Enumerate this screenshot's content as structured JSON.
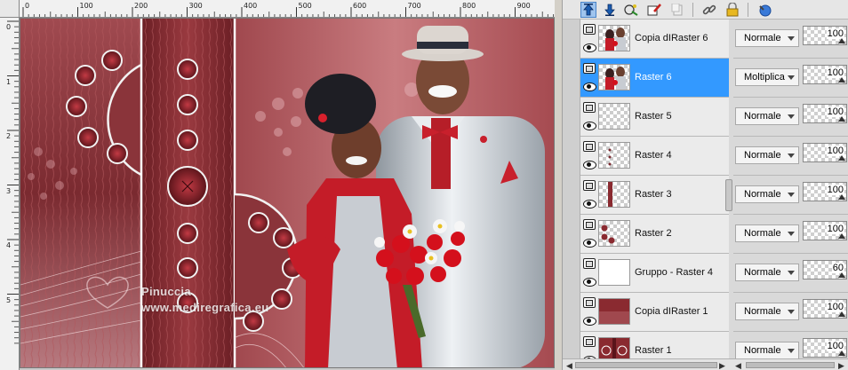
{
  "colors": {
    "selected_row": "#3399ff",
    "palette_bg": "#d9d9d9",
    "art_dark_red": "#7a2a30",
    "art_red": "#c0202a"
  },
  "ruler": {
    "top_labels": [
      "0",
      "100",
      "200",
      "300",
      "400",
      "500",
      "600",
      "700",
      "800",
      "900"
    ],
    "left_labels": [
      "0",
      "1",
      "2",
      "3",
      "4",
      "5"
    ]
  },
  "artwork": {
    "watermark_line1": "Pinuccia",
    "watermark_line2": "www.mediregrafica.eu"
  },
  "toolbar": {
    "icons": [
      "move-up-icon",
      "move-down-icon",
      "new-layer-icon",
      "paint-layer-icon",
      "disabled-icon",
      "link-icon",
      "lock-icon",
      "help-icon"
    ]
  },
  "layers": [
    {
      "name": "Copia dIRaster 6",
      "blend": "Normale",
      "opacity": "100",
      "selected": false,
      "thumb": "couple"
    },
    {
      "name": "Raster 6",
      "blend": "Moltiplica",
      "opacity": "100",
      "selected": true,
      "thumb": "couple"
    },
    {
      "name": "Raster 5",
      "blend": "Normale",
      "opacity": "100",
      "selected": false,
      "thumb": "transparent"
    },
    {
      "name": "Raster 4",
      "blend": "Normale",
      "opacity": "100",
      "selected": false,
      "thumb": "dots"
    },
    {
      "name": "Raster 3",
      "blend": "Normale",
      "opacity": "100",
      "selected": false,
      "thumb": "stripe"
    },
    {
      "name": "Raster 2",
      "blend": "Normale",
      "opacity": "100",
      "selected": false,
      "thumb": "circles"
    },
    {
      "name": "Gruppo - Raster 4",
      "blend": "Normale",
      "opacity": "60",
      "selected": false,
      "thumb": "plain"
    },
    {
      "name": "Copia dIRaster 1",
      "blend": "Normale",
      "opacity": "100",
      "selected": false,
      "thumb": "red"
    },
    {
      "name": "Raster 1",
      "blend": "Normale",
      "opacity": "100",
      "selected": false,
      "thumb": "pattern"
    }
  ]
}
